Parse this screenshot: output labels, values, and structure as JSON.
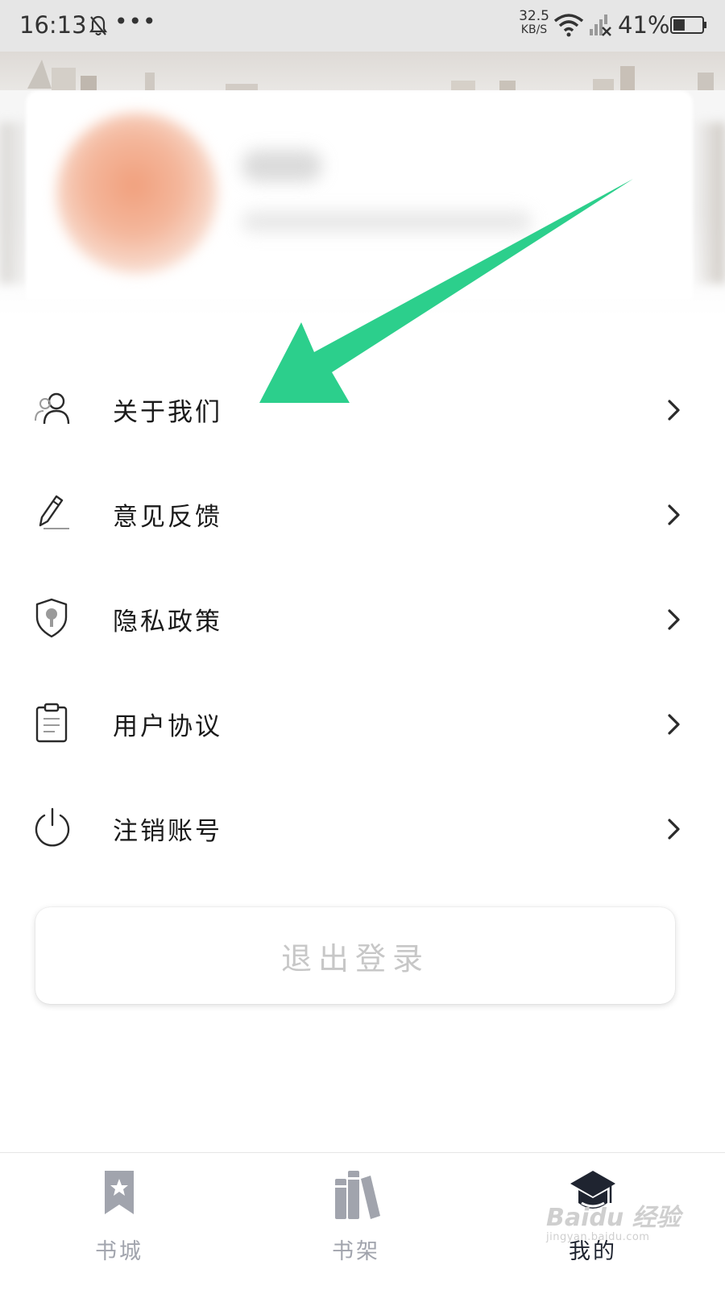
{
  "status_bar": {
    "time": "16:13",
    "more_dots": "•••",
    "net_speed_value": "32.5",
    "net_speed_unit": "KB/S",
    "battery_text": "41%",
    "battery_level": 0.41
  },
  "menu": {
    "items": [
      {
        "label": "关于我们",
        "icon": "user-icon"
      },
      {
        "label": "意见反馈",
        "icon": "pencil-icon"
      },
      {
        "label": "隐私政策",
        "icon": "shield-icon"
      },
      {
        "label": "用户协议",
        "icon": "clipboard-icon"
      },
      {
        "label": "注销账号",
        "icon": "power-icon"
      }
    ]
  },
  "logout_label": "退出登录",
  "bottom_nav": {
    "items": [
      {
        "label": "书城",
        "icon": "bookmark-star-icon",
        "active": false
      },
      {
        "label": "书架",
        "icon": "books-icon",
        "active": false
      },
      {
        "label": "我的",
        "icon": "graduation-cap-icon",
        "active": true
      }
    ]
  },
  "annotation_arrow_color": "#2ccf8c",
  "watermark": {
    "line1": "Baidu 经验",
    "line2": "jingyan.baidu.com"
  }
}
